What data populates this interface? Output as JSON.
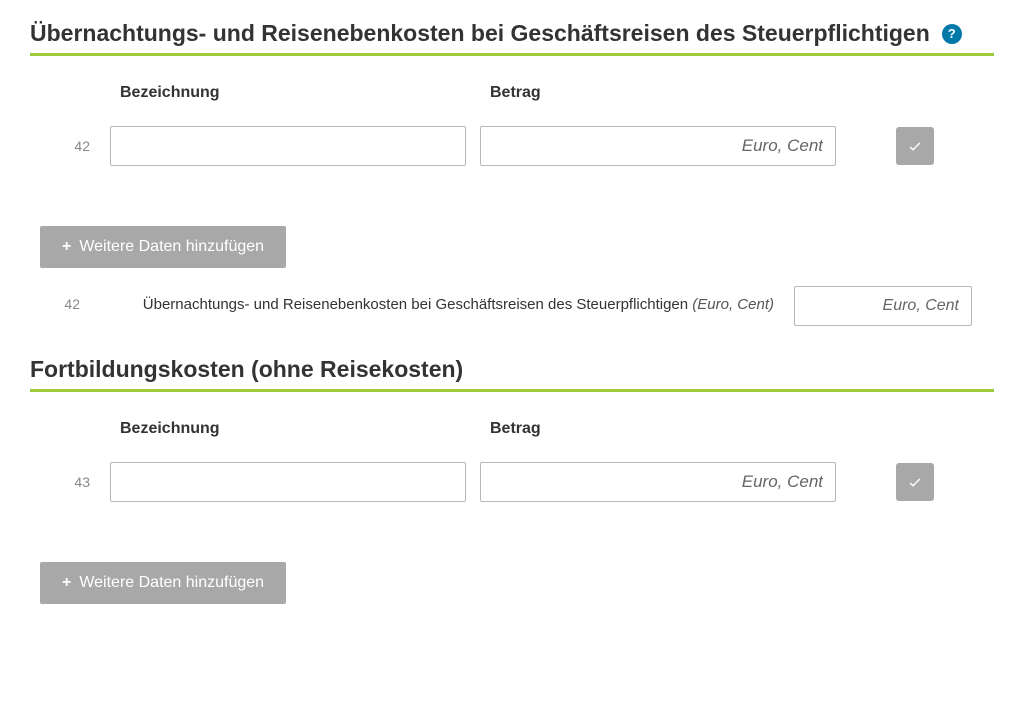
{
  "section1": {
    "title": "Übernachtungs- und Reisenebenkosten bei Geschäftsreisen des Steuerpflichtigen",
    "help_glyph": "?",
    "col_bezeichnung": "Bezeichnung",
    "col_betrag": "Betrag",
    "row_number": "42",
    "amount_placeholder": "Euro, Cent",
    "add_more_label": "Weitere Daten hinzufügen",
    "summary_number": "42",
    "summary_label": "Übernachtungs- und Reisenebenkosten bei Geschäftsreisen des Steuerpflichtigen ",
    "summary_unit": "(Euro, Cent)",
    "summary_placeholder": "Euro, Cent"
  },
  "section2": {
    "title": "Fortbildungskosten (ohne Reisekosten)",
    "col_bezeichnung": "Bezeichnung",
    "col_betrag": "Betrag",
    "row_number": "43",
    "amount_placeholder": "Euro, Cent",
    "add_more_label": "Weitere Daten hinzufügen"
  },
  "icons": {
    "plus": "+"
  }
}
